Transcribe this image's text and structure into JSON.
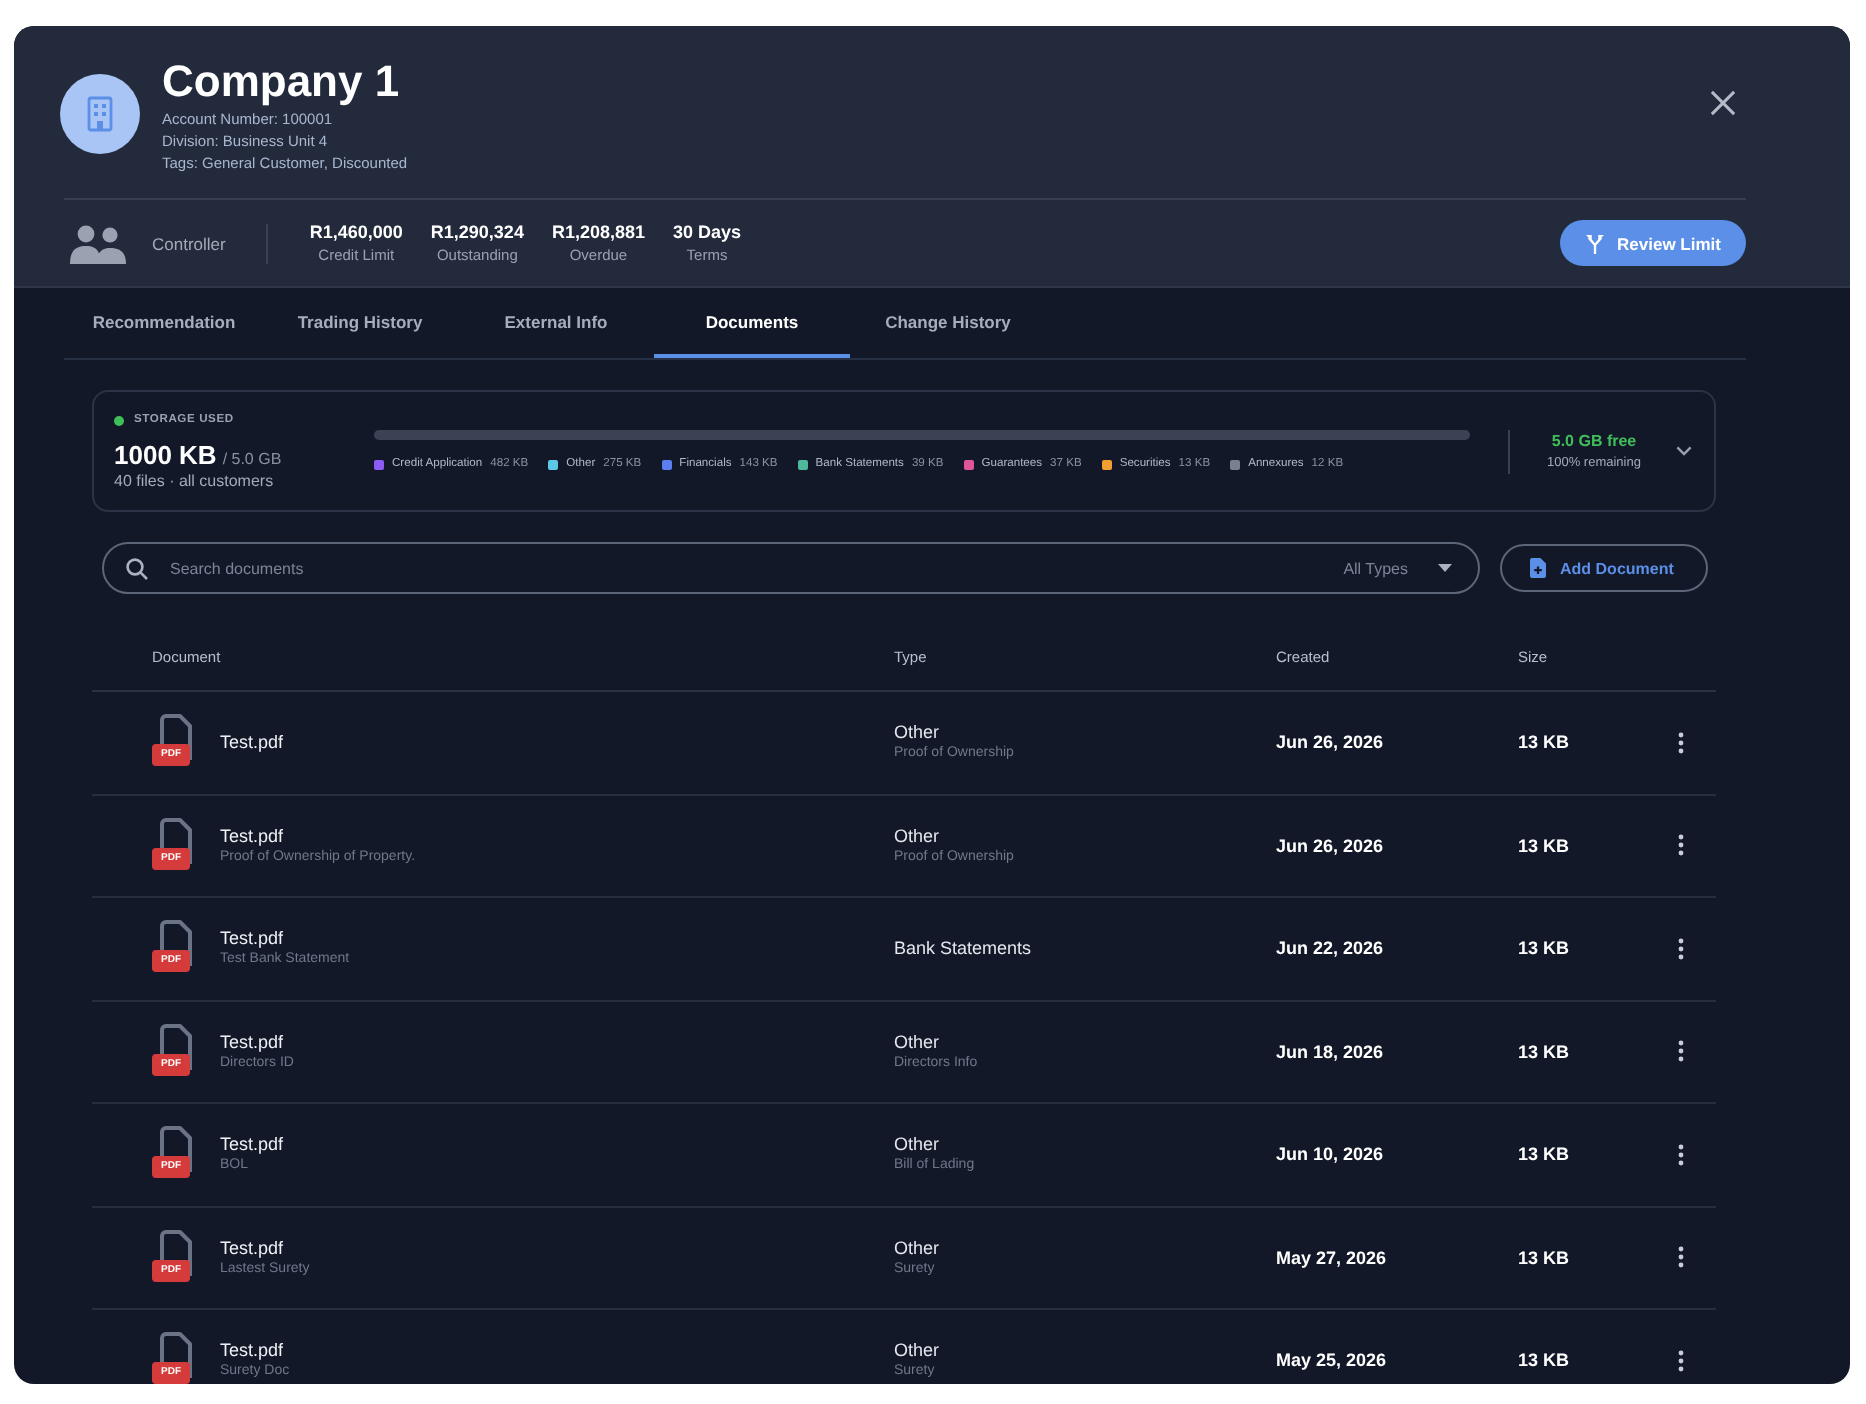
{
  "header": {
    "title": "Company 1",
    "meta": [
      "Account Number: 100001",
      "Division: Business Unit 4",
      "Tags: General Customer, Discounted"
    ]
  },
  "summary": {
    "role": "Controller",
    "stats": [
      {
        "value": "R1,460,000",
        "label": "Credit Limit"
      },
      {
        "value": "R1,290,324",
        "label": "Outstanding"
      },
      {
        "value": "R1,208,881",
        "label": "Overdue"
      },
      {
        "value": "30 Days",
        "label": "Terms"
      }
    ],
    "action": "Review Limit"
  },
  "tabs": [
    {
      "label": "Recommendation",
      "selected": false
    },
    {
      "label": "Trading History",
      "selected": false
    },
    {
      "label": "External Info",
      "selected": false
    },
    {
      "label": "Documents",
      "selected": true
    },
    {
      "label": "Change History",
      "selected": false
    }
  ],
  "storage": {
    "label": "STORAGE USED",
    "used": "1000 KB",
    "total": "/ 5.0 GB",
    "files": "40 files · all customers",
    "legend": [
      {
        "name": "Credit Application",
        "size": "482 KB",
        "color": "#8b5cf6"
      },
      {
        "name": "Other",
        "size": "275 KB",
        "color": "#5cc8e6"
      },
      {
        "name": "Financials",
        "size": "143 KB",
        "color": "#5b7ff0"
      },
      {
        "name": "Bank Statements",
        "size": "39 KB",
        "color": "#4db89a"
      },
      {
        "name": "Guarantees",
        "size": "37 KB",
        "color": "#e0559a"
      },
      {
        "name": "Securities",
        "size": "13 KB",
        "color": "#f0a030"
      },
      {
        "name": "Annexures",
        "size": "12 KB",
        "color": "#7a8090"
      }
    ],
    "free": "5.0 GB free",
    "remaining": "100% remaining"
  },
  "toolbar": {
    "search": {
      "placeholder": "Search documents"
    },
    "type_filter": "All Types",
    "add_button": "Add Document"
  },
  "table": {
    "columns": [
      "Document",
      "Type",
      "Created",
      "Size"
    ],
    "rows": [
      {
        "badge": "PDF",
        "name": "Test.pdf",
        "type": "Other",
        "subtype": "Proof of Ownership",
        "created": "Jun 26, 2026",
        "size": "13 KB"
      },
      {
        "badge": "PDF",
        "name": "Test.pdf",
        "description": "Proof of Ownership of Property.",
        "type": "Other",
        "subtype": "Proof of Ownership",
        "created": "Jun 26, 2026",
        "size": "13 KB"
      },
      {
        "badge": "PDF",
        "name": "Test.pdf",
        "description": "Test Bank Statement",
        "type": "Bank Statements",
        "created": "Jun 22, 2026",
        "size": "13 KB"
      },
      {
        "badge": "PDF",
        "name": "Test.pdf",
        "description": "Directors ID",
        "type": "Other",
        "subtype": "Directors Info",
        "created": "Jun 18, 2026",
        "size": "13 KB"
      },
      {
        "badge": "PDF",
        "name": "Test.pdf",
        "description": "BOL",
        "type": "Other",
        "subtype": "Bill of Lading",
        "created": "Jun 10, 2026",
        "size": "13 KB"
      },
      {
        "badge": "PDF",
        "name": "Test.pdf",
        "description": "Lastest Surety",
        "type": "Other",
        "subtype": "Surety",
        "created": "May 27, 2026",
        "size": "13 KB"
      },
      {
        "badge": "PDF",
        "name": "Test.pdf",
        "description": "Surety Doc",
        "type": "Other",
        "subtype": "Surety",
        "created": "May 25, 2026",
        "size": "13 KB"
      }
    ]
  }
}
